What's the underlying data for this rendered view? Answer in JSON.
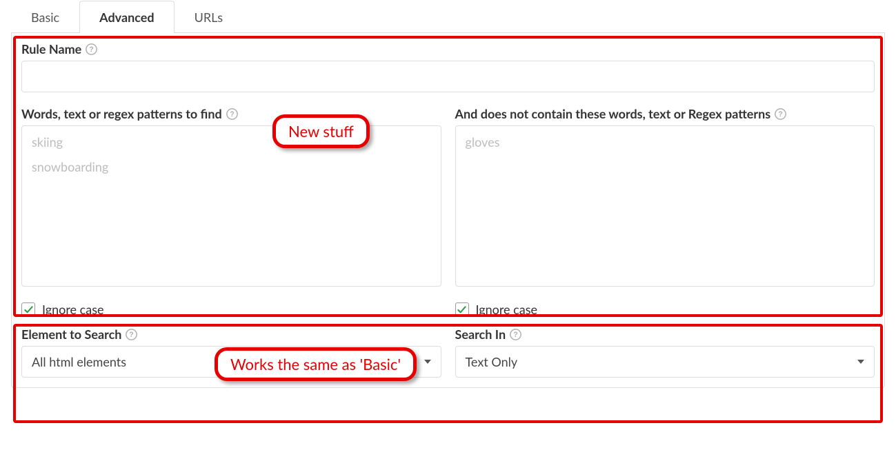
{
  "tabs": {
    "basic": "Basic",
    "advanced": "Advanced",
    "urls": "URLs"
  },
  "ruleName": {
    "label": "Rule Name",
    "value": ""
  },
  "findWords": {
    "label": "Words, text or regex patterns to find",
    "tags": [
      "skiing",
      "snowboarding"
    ]
  },
  "excludeWords": {
    "label": "And does not contain these words, text or Regex patterns",
    "tags": [
      "gloves"
    ]
  },
  "left": {
    "ignoreCase": {
      "label": "Ignore case",
      "checked": true
    },
    "elementToSearch": {
      "label": "Element to Search",
      "value": "All html elements"
    }
  },
  "right": {
    "ignoreCase": {
      "label": "Ignore case",
      "checked": true
    },
    "searchIn": {
      "label": "Search In",
      "value": "Text Only"
    }
  },
  "annotations": {
    "newStuff": "New stuff",
    "sameAsBasic": "Works the same as 'Basic'"
  }
}
